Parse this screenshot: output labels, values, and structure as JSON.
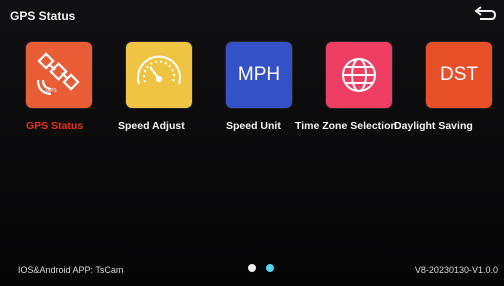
{
  "header": {
    "title": "GPS Status"
  },
  "apps": [
    {
      "label": "GPS Status",
      "active": true,
      "color": "#e85c36"
    },
    {
      "label": "Speed Adjust",
      "active": false,
      "color": "#f0c443"
    },
    {
      "label": "Speed Unit",
      "active": false,
      "color": "#3451c8",
      "tile_text": "MPH"
    },
    {
      "label": "Time Zone Selection",
      "active": false,
      "color": "#ef3e63"
    },
    {
      "label": "Daylight Saving",
      "active": false,
      "color": "#e8502a",
      "tile_text": "DST"
    }
  ],
  "footer": {
    "app_info": "IOS&Android APP: TsCam",
    "version": "V8-20230130-V1.0.0"
  },
  "pager": {
    "page_count": 2,
    "current_page": 2
  }
}
